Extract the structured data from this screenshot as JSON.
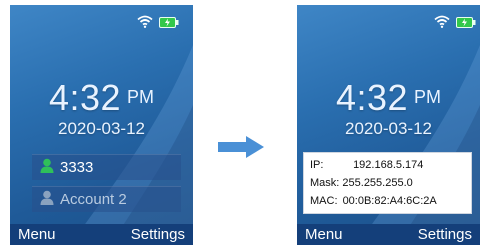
{
  "left_screen": {
    "time": "4:32",
    "ampm": "PM",
    "date": "2020-03-12",
    "accounts": [
      {
        "label": "3333",
        "state": "active",
        "color": "#2fc05a"
      },
      {
        "label": "Account 2",
        "state": "inactive",
        "color": "#8aa2bf"
      }
    ],
    "softkeys": {
      "left": "Menu",
      "right": "Settings"
    },
    "icons": [
      "wifi-icon",
      "battery-charging-icon"
    ]
  },
  "arrow_icon": "arrow-right-icon",
  "right_screen": {
    "time": "4:32",
    "ampm": "PM",
    "date": "2020-03-12",
    "network_info": {
      "ip_label": "IP:",
      "ip_value": "192.168.5.174",
      "mask_label": "Mask:",
      "mask_value": "255.255.255.0",
      "mac_label": "MAC:",
      "mac_value": "00:0B:82:A4:6C:2A"
    },
    "softkeys": {
      "left": "Menu",
      "right": "Settings"
    },
    "icons": [
      "wifi-icon",
      "battery-charging-icon"
    ]
  },
  "colors": {
    "screen_bg": "#2a6fb0",
    "softkey_bar": "#143f7a",
    "arrow": "#4a90d6",
    "battery": "#32c84b"
  }
}
